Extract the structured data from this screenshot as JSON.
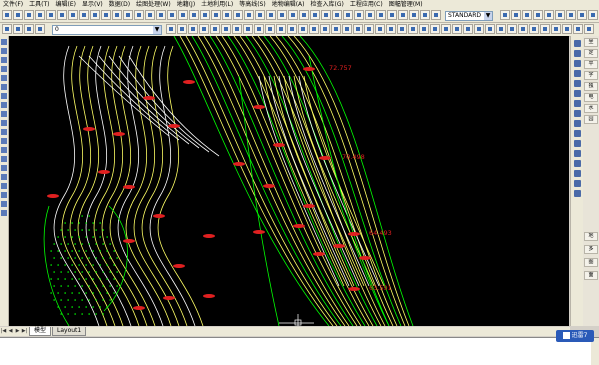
{
  "menu": {
    "items": [
      "文件(F)",
      "工具(T)",
      "编辑(E)",
      "显示(V)",
      "数据(D)",
      "绘图处理(W)",
      "地籍(J)",
      "土地利用(L)",
      "等高线(S)",
      "地物编辑(A)",
      "检查入库(G)",
      "工程应用(C)",
      "图幅管理(M)"
    ]
  },
  "toolbar": {
    "style_combo": "STANDARD",
    "layer_combo": "0"
  },
  "drawing": {
    "labels": [
      {
        "text": "72.757"
      },
      {
        "text": "70.498"
      },
      {
        "text": "64.493"
      },
      {
        "text": "63.591"
      }
    ],
    "background": "#000000",
    "line_colors": [
      "#ffff66",
      "#00ff00",
      "#ffffff",
      "#e02020"
    ]
  },
  "right_panel": {
    "items": [
      "坐",
      "定",
      "平",
      "字",
      "独",
      "电",
      "水",
      "园",
      "地",
      "多",
      "图",
      "面"
    ]
  },
  "tabs": {
    "nav": [
      "|◀",
      "◀",
      "▶",
      "▶|"
    ],
    "items": [
      "模型",
      "Layout1"
    ],
    "active": "模型"
  },
  "notification": {
    "label": "迅雷7"
  }
}
